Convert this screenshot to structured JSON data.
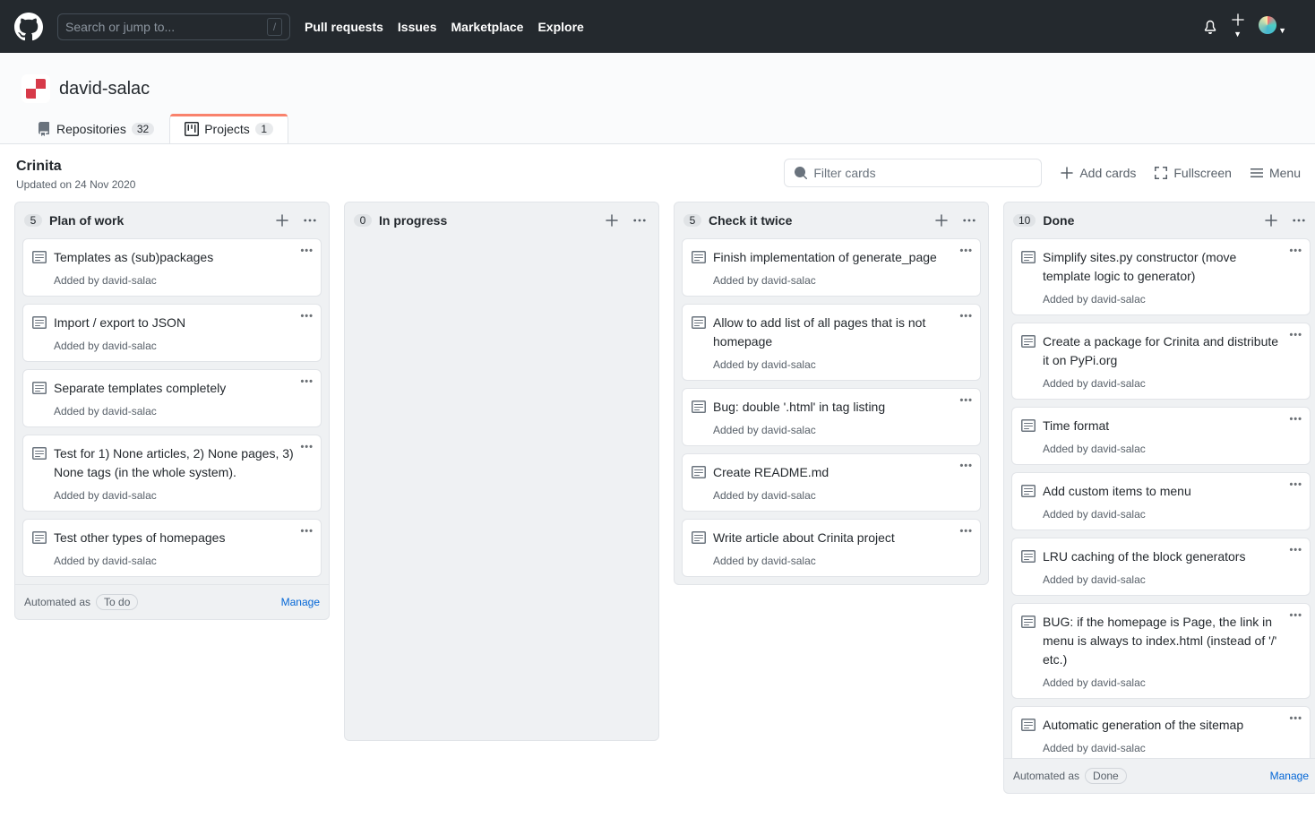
{
  "header": {
    "search_placeholder": "Search or jump to...",
    "nav": [
      "Pull requests",
      "Issues",
      "Marketplace",
      "Explore"
    ]
  },
  "profile": {
    "name": "david-salac",
    "tabs": {
      "repositories": {
        "label": "Repositories",
        "count": "32"
      },
      "projects": {
        "label": "Projects",
        "count": "1"
      }
    }
  },
  "project": {
    "title": "Crinita",
    "updated": "Updated on 24 Nov 2020",
    "filter_placeholder": "Filter cards",
    "add_cards": "Add cards",
    "fullscreen": "Fullscreen",
    "menu": "Menu"
  },
  "footer": {
    "automated": "Automated as",
    "manage": "Manage"
  },
  "columns": [
    {
      "count": "5",
      "title": "Plan of work",
      "footer_pill": "To do",
      "has_footer": true,
      "cards": [
        {
          "title": "Templates as (sub)packages",
          "added_by_prefix": "Added by ",
          "added_by": "david-salac"
        },
        {
          "title": "Import / export to JSON",
          "added_by_prefix": "Added by ",
          "added_by": "david-salac"
        },
        {
          "title": "Separate templates completely",
          "added_by_prefix": "Added by ",
          "added_by": "david-salac"
        },
        {
          "title": "Test for 1) None articles, 2) None pages, 3) None tags (in the whole system).",
          "added_by_prefix": "Added by ",
          "added_by": "david-salac"
        },
        {
          "title": "Test other types of homepages",
          "added_by_prefix": "Added by ",
          "added_by": "david-salac"
        }
      ]
    },
    {
      "count": "0",
      "title": "In progress",
      "has_footer": false,
      "cards": []
    },
    {
      "count": "5",
      "title": "Check it twice",
      "has_footer": false,
      "cards": [
        {
          "title": "Finish implementation of generate_page",
          "added_by_prefix": "Added by ",
          "added_by": "david-salac"
        },
        {
          "title": "Allow to add list of all pages that is not homepage",
          "added_by_prefix": "Added by ",
          "added_by": "david-salac"
        },
        {
          "title": "Bug: double '.html' in tag listing",
          "added_by_prefix": "Added by ",
          "added_by": "david-salac"
        },
        {
          "title": "Create README.md",
          "added_by_prefix": "Added by ",
          "added_by": "david-salac"
        },
        {
          "title": "Write article about Crinita project",
          "added_by_prefix": "Added by ",
          "added_by": "david-salac"
        }
      ]
    },
    {
      "count": "10",
      "title": "Done",
      "footer_pill": "Done",
      "has_footer": true,
      "tall": true,
      "cards": [
        {
          "title": "Simplify sites.py constructor (move template logic to generator)",
          "added_by_prefix": "Added by ",
          "added_by": "david-salac"
        },
        {
          "title": "Create a package for Crinita and distribute it on PyPi.org",
          "added_by_prefix": "Added by ",
          "added_by": "david-salac"
        },
        {
          "title": "Time format",
          "added_by_prefix": "Added by ",
          "added_by": "david-salac"
        },
        {
          "title": "Add custom items to menu",
          "added_by_prefix": "Added by ",
          "added_by": "david-salac"
        },
        {
          "title": "LRU caching of the block generators",
          "added_by_prefix": "Added by ",
          "added_by": "david-salac"
        },
        {
          "title": "BUG: if the homepage is Page, the link in menu is always to index.html (instead of '/' etc.)",
          "added_by_prefix": "Added by ",
          "added_by": "david-salac"
        },
        {
          "title": "Automatic generation of the sitemap",
          "added_by_prefix": "Added by ",
          "added_by": "david-salac"
        }
      ]
    }
  ]
}
